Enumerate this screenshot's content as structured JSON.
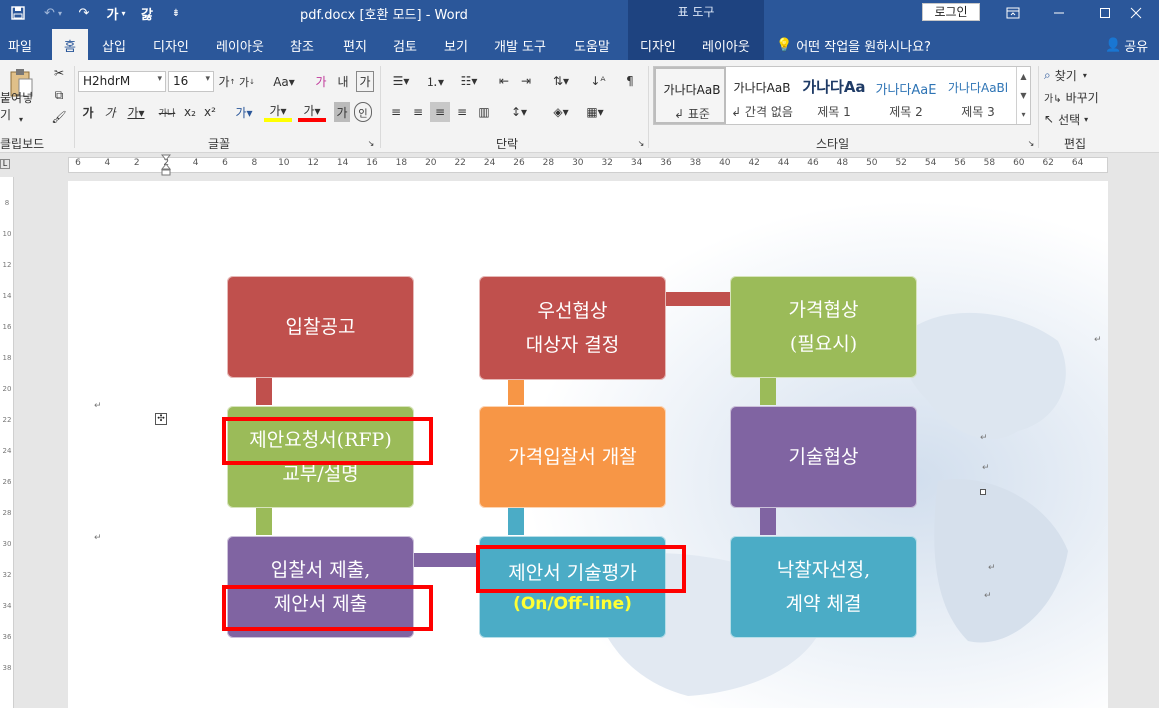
{
  "titlebar": {
    "doc_title": "pdf.docx [호환 모드]  -  Word",
    "tool_tab": "표 도구",
    "login_label": "로그인",
    "bg_color": "#2b579a"
  },
  "tabs": [
    "파일",
    "홈",
    "삽입",
    "디자인",
    "레이아웃",
    "참조",
    "편지",
    "검토",
    "보기",
    "개발 도구",
    "도움말",
    "디자인",
    "레이아웃"
  ],
  "tell_me": "어떤 작업을 원하시나요?",
  "share_label": "공유",
  "ribbon": {
    "clipboard": {
      "paste_label": "붙여넣기",
      "group_label": "클립보드"
    },
    "font": {
      "font_name": "H2hdrM",
      "font_size": "16",
      "group_label": "글꼴"
    },
    "paragraph": {
      "group_label": "단락"
    },
    "styles": {
      "group_label": "스타일",
      "items": [
        {
          "sample": "가나다AaB",
          "name": "↲ 표준"
        },
        {
          "sample": "가나다AaB",
          "name": "↲ 간격 없음"
        },
        {
          "sample": "가나다Aa",
          "name": "제목 1"
        },
        {
          "sample": "가나다AaE",
          "name": "제목 2"
        },
        {
          "sample": "가나다AaBl",
          "name": "제목 3"
        }
      ]
    },
    "editing": {
      "find_label": "찾기",
      "replace_label": "바꾸기",
      "select_label": "선택",
      "group_label": "편집"
    }
  },
  "ruler_ticks": [
    "6",
    "4",
    "2",
    "2",
    "4",
    "6",
    "8",
    "10",
    "12",
    "14",
    "16",
    "18",
    "20",
    "22",
    "24",
    "26",
    "28",
    "30",
    "32",
    "34",
    "36",
    "38",
    "40",
    "42",
    "44",
    "46",
    "48",
    "50",
    "52",
    "54",
    "56",
    "58",
    "60",
    "62",
    "64"
  ],
  "vruler_ticks": [
    "8",
    "10",
    "12",
    "14",
    "16",
    "18",
    "20",
    "22",
    "24",
    "26",
    "28",
    "30",
    "32",
    "34",
    "36",
    "38"
  ],
  "diagram": {
    "boxes": [
      {
        "id": "bid-notice",
        "line1": "입찰공고",
        "line2": "",
        "color": "#c0504d"
      },
      {
        "id": "rfp-distribution",
        "line1": "제안요청서(RFP)",
        "line2": "교부/설명",
        "color": "#9bbb59"
      },
      {
        "id": "bid-submission",
        "line1": "입찰서 제출,",
        "line2": "제안서 제출",
        "color": "#8064a2"
      },
      {
        "id": "priority-negotiation",
        "line1": "우선협상",
        "line2": "대상자 결정",
        "color": "#c0504d"
      },
      {
        "id": "price-bid-opening",
        "line1": "가격입찰서 개찰",
        "line2": "",
        "color": "#f79646"
      },
      {
        "id": "tech-evaluation",
        "line1": "제안서 기술평가",
        "line2": "(On/Off-line)",
        "color": "#4bacc6"
      },
      {
        "id": "price-negotiation",
        "line1": "가격협상",
        "line2": "(필요시)",
        "color": "#9bbb59"
      },
      {
        "id": "tech-negotiation",
        "line1": "기술협상",
        "line2": "",
        "color": "#8064a2"
      },
      {
        "id": "award-contract",
        "line1": "낙찰자선정,",
        "line2": "계약 체결",
        "color": "#4bacc6"
      }
    ],
    "highlight_color": "#ff0000"
  }
}
